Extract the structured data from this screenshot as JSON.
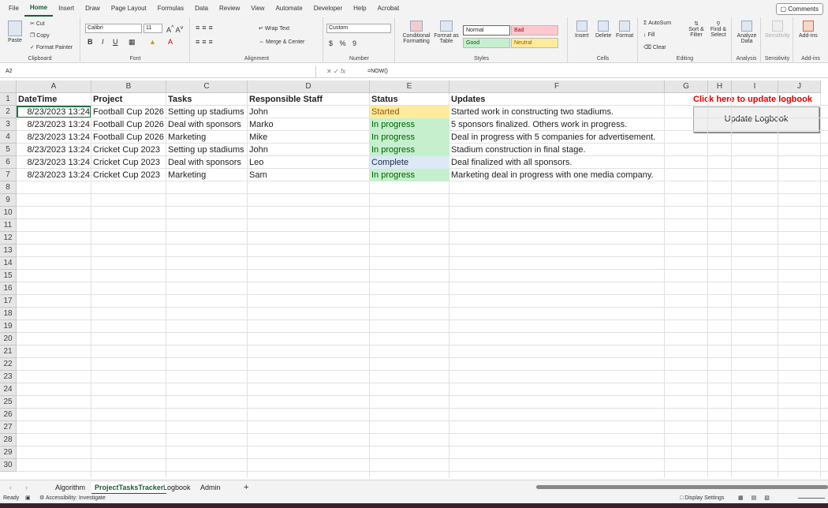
{
  "menu": [
    "File",
    "Home",
    "Insert",
    "Draw",
    "Page Layout",
    "Formulas",
    "Data",
    "Review",
    "View",
    "Automate",
    "Developer",
    "Help",
    "Acrobat"
  ],
  "comments_label": "Comments",
  "ribbon": {
    "clipboard": {
      "paste": "Paste",
      "cut": "Cut",
      "copy": "Copy",
      "format_painter": "Format Painter",
      "label": "Clipboard"
    },
    "font": {
      "family": "Calibri",
      "size": "11",
      "bold": "B",
      "italic": "I",
      "underline": "U",
      "label": "Font"
    },
    "alignment": {
      "wrap": "Wrap Text",
      "merge": "Merge & Center",
      "label": "Alignment"
    },
    "number": {
      "format": "Custom",
      "label": "Number"
    },
    "styles": {
      "conditional": "Conditional Formatting",
      "format_table": "Format as Table",
      "normal": "Normal",
      "bad": "Bad",
      "good": "Good",
      "neutral": "Neutral",
      "label": "Styles"
    },
    "cells": {
      "insert": "Insert",
      "delete": "Delete",
      "format": "Format",
      "label": "Cells"
    },
    "editing": {
      "autosum": "AutoSum",
      "fill": "Fill",
      "clear": "Clear",
      "sort": "Sort & Filter",
      "find": "Find & Select",
      "label": "Editing"
    },
    "analysis": {
      "analyze": "Analyze Data",
      "label": "Analysis"
    },
    "sensitivity": {
      "btn": "Sensitivity",
      "label": "Sensitivity"
    },
    "addins": {
      "btn": "Add-ins",
      "label": "Add-ins"
    }
  },
  "formula_bar": {
    "name_box": "A2",
    "formula": "=NOW()"
  },
  "columns": [
    "A",
    "B",
    "C",
    "D",
    "E",
    "F",
    "G",
    "H",
    "I",
    "J"
  ],
  "rows": [
    "1",
    "2",
    "3",
    "4",
    "5",
    "6",
    "7",
    "8",
    "9",
    "10",
    "11",
    "12",
    "13",
    "14",
    "15",
    "16",
    "17",
    "18",
    "19",
    "20",
    "21",
    "22",
    "23",
    "24",
    "25",
    "26",
    "27",
    "28",
    "29",
    "30"
  ],
  "table": {
    "headers": [
      "DateTime",
      "Project",
      "Tasks",
      "Responsible Staff",
      "Status",
      "Updates"
    ],
    "rows": [
      [
        "8/23/2023 13:24",
        "Football Cup 2026",
        "Setting up stadiums",
        "John",
        "Started",
        "Started work in constructing two stadiums."
      ],
      [
        "8/23/2023 13:24",
        "Football Cup 2026",
        "Deal with sponsors",
        "Marko",
        "In progress",
        "5 sponsors finalized. Others work in progress."
      ],
      [
        "8/23/2023 13:24",
        "Football Cup 2026",
        "Marketing",
        "Mike",
        "In progress",
        "Deal in progress with 5 companies for advertisement."
      ],
      [
        "8/23/2023 13:24",
        "Cricket Cup 2023",
        "Setting up stadiums",
        "John",
        "In progress",
        "Stadium construction in final stage."
      ],
      [
        "8/23/2023 13:24",
        "Cricket Cup 2023",
        "Deal with sponsors",
        "Leo",
        "Complete",
        "Deal finalized with all sponsors."
      ],
      [
        "8/23/2023 13:24",
        "Cricket Cup 2023",
        "Marketing",
        "Sam",
        "In progress",
        "Marketing deal in progress with one media company."
      ]
    ]
  },
  "note": "Click here to update logbook",
  "update_button": "Update Logbook",
  "sheets": [
    "Algorithm",
    "ProjectTasksTracker",
    "Logbook",
    "Admin"
  ],
  "add_sheet": "+",
  "status": {
    "ready": "Ready",
    "accessibility": "Accessibility: Investigate",
    "display": "Display Settings"
  },
  "colors": {
    "started_bg": "#ffeb9c",
    "progress_bg": "#c6efce",
    "complete_bg": "#dde9f6",
    "accent": "#217346"
  }
}
